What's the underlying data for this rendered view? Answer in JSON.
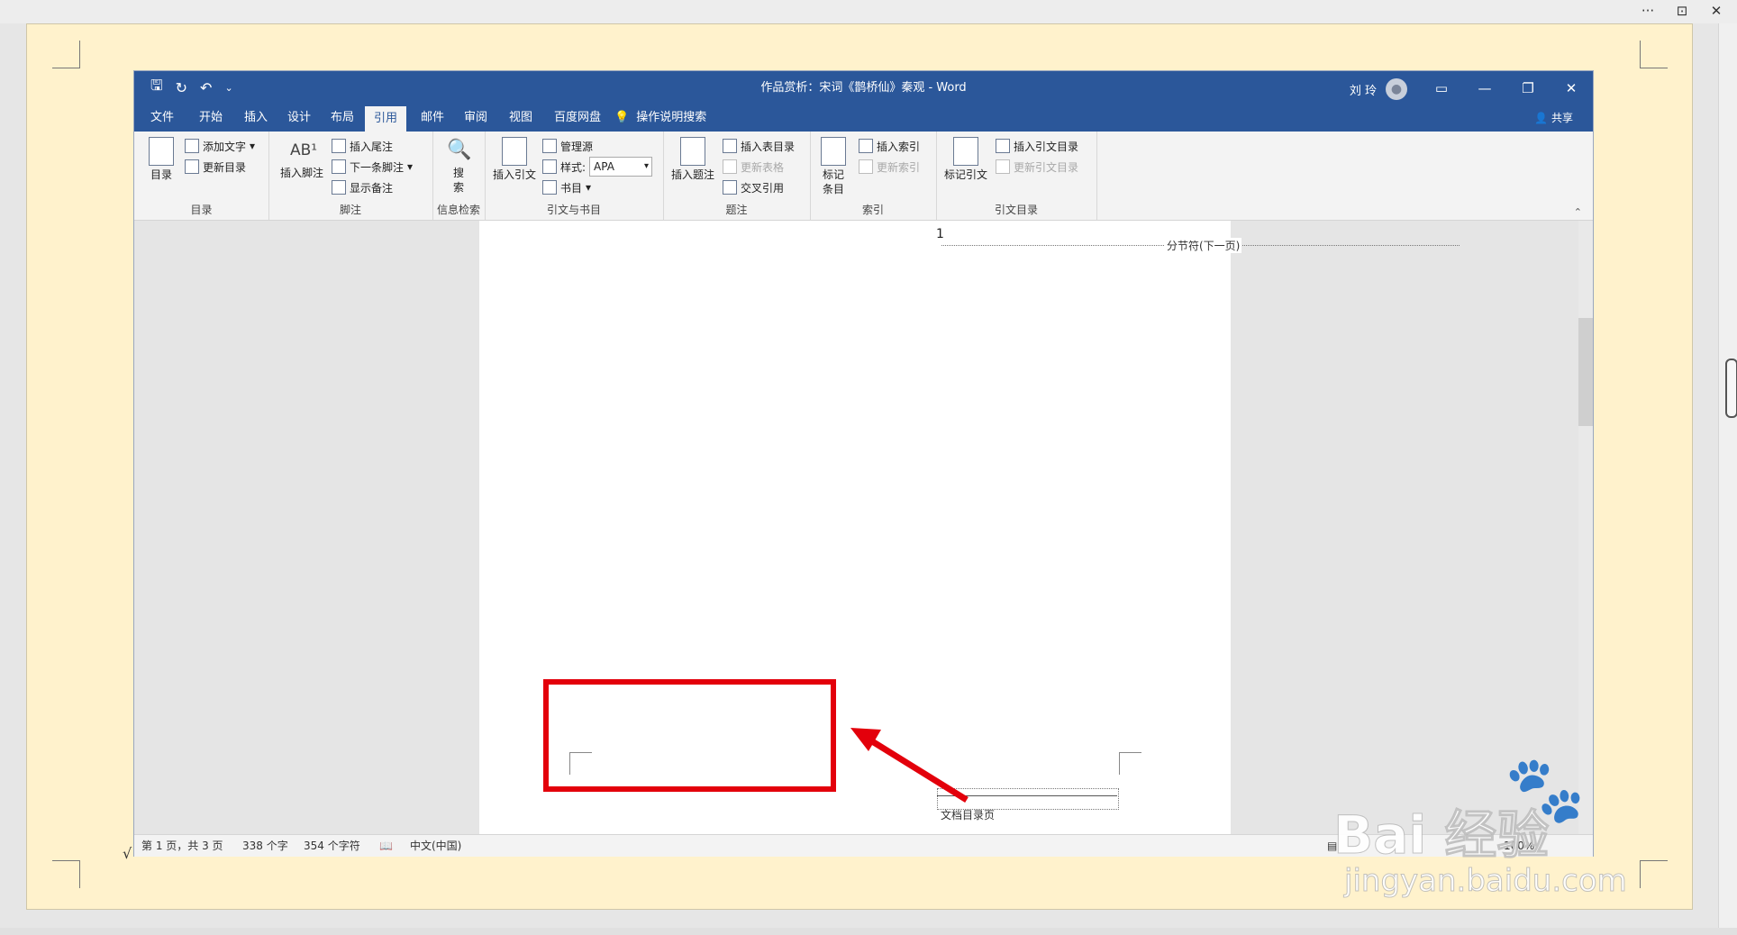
{
  "viewer": {
    "controls": [
      "···",
      "⊡",
      "✕"
    ]
  },
  "window": {
    "title": "作品赏析：宋词《鹊桥仙》秦观 - Word",
    "user": "刘 玲",
    "buttons": {
      "ribbon_display": "▭",
      "minimize": "—",
      "restore": "❐",
      "close": "✕"
    }
  },
  "tabs": [
    "文件",
    "开始",
    "插入",
    "设计",
    "布局",
    "引用",
    "邮件",
    "审阅",
    "视图",
    "百度网盘"
  ],
  "active_tab": "引用",
  "tellme": "操作说明搜索",
  "share": "共享",
  "ribbon": {
    "toc": {
      "label": "目录",
      "big": "目录",
      "add_text": "添加文字",
      "update": "更新目录"
    },
    "footnotes": {
      "label": "脚注",
      "insert_footnote": "插入脚注",
      "insert_endnote": "插入尾注",
      "next_footnote": "下一条脚注",
      "show_notes": "显示备注"
    },
    "research": {
      "label": "信息检索",
      "search": "搜索"
    },
    "citations": {
      "label": "引文与书目",
      "insert_citation": "插入引文",
      "manage_sources": "管理源",
      "style_label": "样式:",
      "style_value": "APA",
      "bibliography": "书目"
    },
    "captions": {
      "label": "题注",
      "insert_caption": "插入题注",
      "insert_table_of_figures": "插入表目录",
      "update_table": "更新表格",
      "cross_reference": "交叉引用"
    },
    "index": {
      "label": "索引",
      "mark_entry": "标记条目",
      "insert_index": "插入索引",
      "update_index": "更新索引"
    },
    "toa": {
      "label": "引文目录",
      "mark_citation": "标记引文",
      "insert_toa": "插入引文目录",
      "update_toa": "更新引文目录"
    }
  },
  "document": {
    "page_number": "1",
    "section_break": "分节符(下一页)",
    "footer_text": "文档目录页"
  },
  "status": {
    "page": "第 1 页，共 3 页",
    "words": "338 个字",
    "chars": "354 个字符",
    "language": "中文(中国)",
    "zoom": "100%"
  },
  "watermark": {
    "brand": "Bai 经验",
    "url": "jingyan.baidu.com"
  },
  "colors": {
    "title_bar": "#2b579a",
    "highlight": "#e3000b",
    "paper": "#fff2cc"
  }
}
